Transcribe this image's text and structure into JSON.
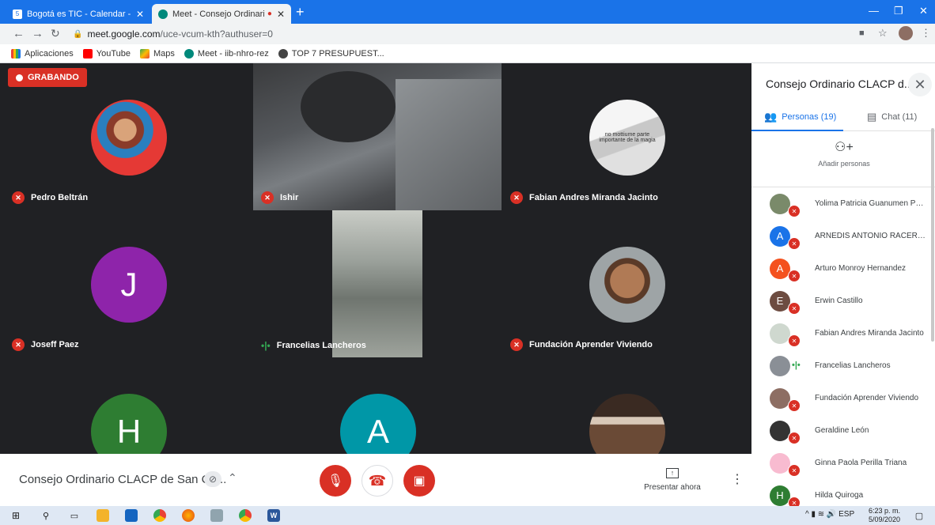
{
  "browser": {
    "tabs": [
      {
        "title": "Bogotá es TIC - Calendar - sábad",
        "close": "✕"
      },
      {
        "title": "Meet - Consejo Ordinario CL",
        "close": "✕"
      }
    ],
    "new_tab": "+",
    "url_host": "meet.google.com",
    "url_path": "/uce-vcum-kth?authuser=0",
    "bookmarks": [
      "Aplicaciones",
      "YouTube",
      "Maps",
      "Meet - iib-nhro-rez",
      "TOP 7 PRESUPUEST..."
    ]
  },
  "meet": {
    "recording_label": "GRABANDO",
    "tiles": [
      {
        "name": "Pedro Beltrán",
        "state": "muted"
      },
      {
        "name": "Ishir",
        "state": "muted"
      },
      {
        "name": "Fabian Andres Miranda Jacinto",
        "state": "muted"
      },
      {
        "name": "Joseff Paez",
        "state": "muted",
        "initial": "J"
      },
      {
        "name": "Francelias Lancheros",
        "state": "speaking"
      },
      {
        "name": "Fundación Aprender Viviendo",
        "state": "muted"
      },
      {
        "initial": "H"
      },
      {
        "initial": "A"
      }
    ],
    "thumb_caption": "no mottiume parte importante de la magia",
    "meeting_title": "Consejo Ordinario CLACP de San Cri...",
    "present_label": "Presentar ahora"
  },
  "panel": {
    "title": "Consejo Ordinario CLACP d...",
    "tab_people": "Personas (19)",
    "tab_chat": "Chat (11)",
    "add_people": "Añadir personas",
    "participants": [
      {
        "name": "Yolima Patricia Guanumen Pac...",
        "initial": "",
        "color": "#7a8a6a",
        "state": "muted"
      },
      {
        "name": "ARNEDIS ANTONIO RACERO A...",
        "initial": "A",
        "color": "#1a73e8",
        "state": "muted"
      },
      {
        "name": "Arturo Monroy Hernandez",
        "initial": "A",
        "color": "#f4511e",
        "state": "muted"
      },
      {
        "name": "Erwin Castillo",
        "initial": "E",
        "color": "#6d4c41",
        "state": "muted"
      },
      {
        "name": "Fabian Andres Miranda Jacinto",
        "initial": "",
        "color": "#cfd8cf",
        "state": "muted"
      },
      {
        "name": "Francelias Lancheros",
        "initial": "",
        "color": "#8a8f96",
        "state": "speaking"
      },
      {
        "name": "Fundación Aprender Viviendo",
        "initial": "",
        "color": "#8d6e63",
        "state": "muted"
      },
      {
        "name": "Geraldine León",
        "initial": "",
        "color": "#333333",
        "state": "muted"
      },
      {
        "name": "Ginna Paola Perilla Triana",
        "initial": "",
        "color": "#f8bbd0",
        "state": "muted"
      },
      {
        "name": "Hilda Quiroga",
        "initial": "H",
        "color": "#2e7d32",
        "state": "muted"
      }
    ]
  },
  "taskbar": {
    "lang": "ESP",
    "time": "6:23 p. m.",
    "date": "5/09/2020"
  },
  "colors": {
    "accent": "#1a73e8",
    "danger": "#d93025",
    "speaking": "#34a853"
  }
}
